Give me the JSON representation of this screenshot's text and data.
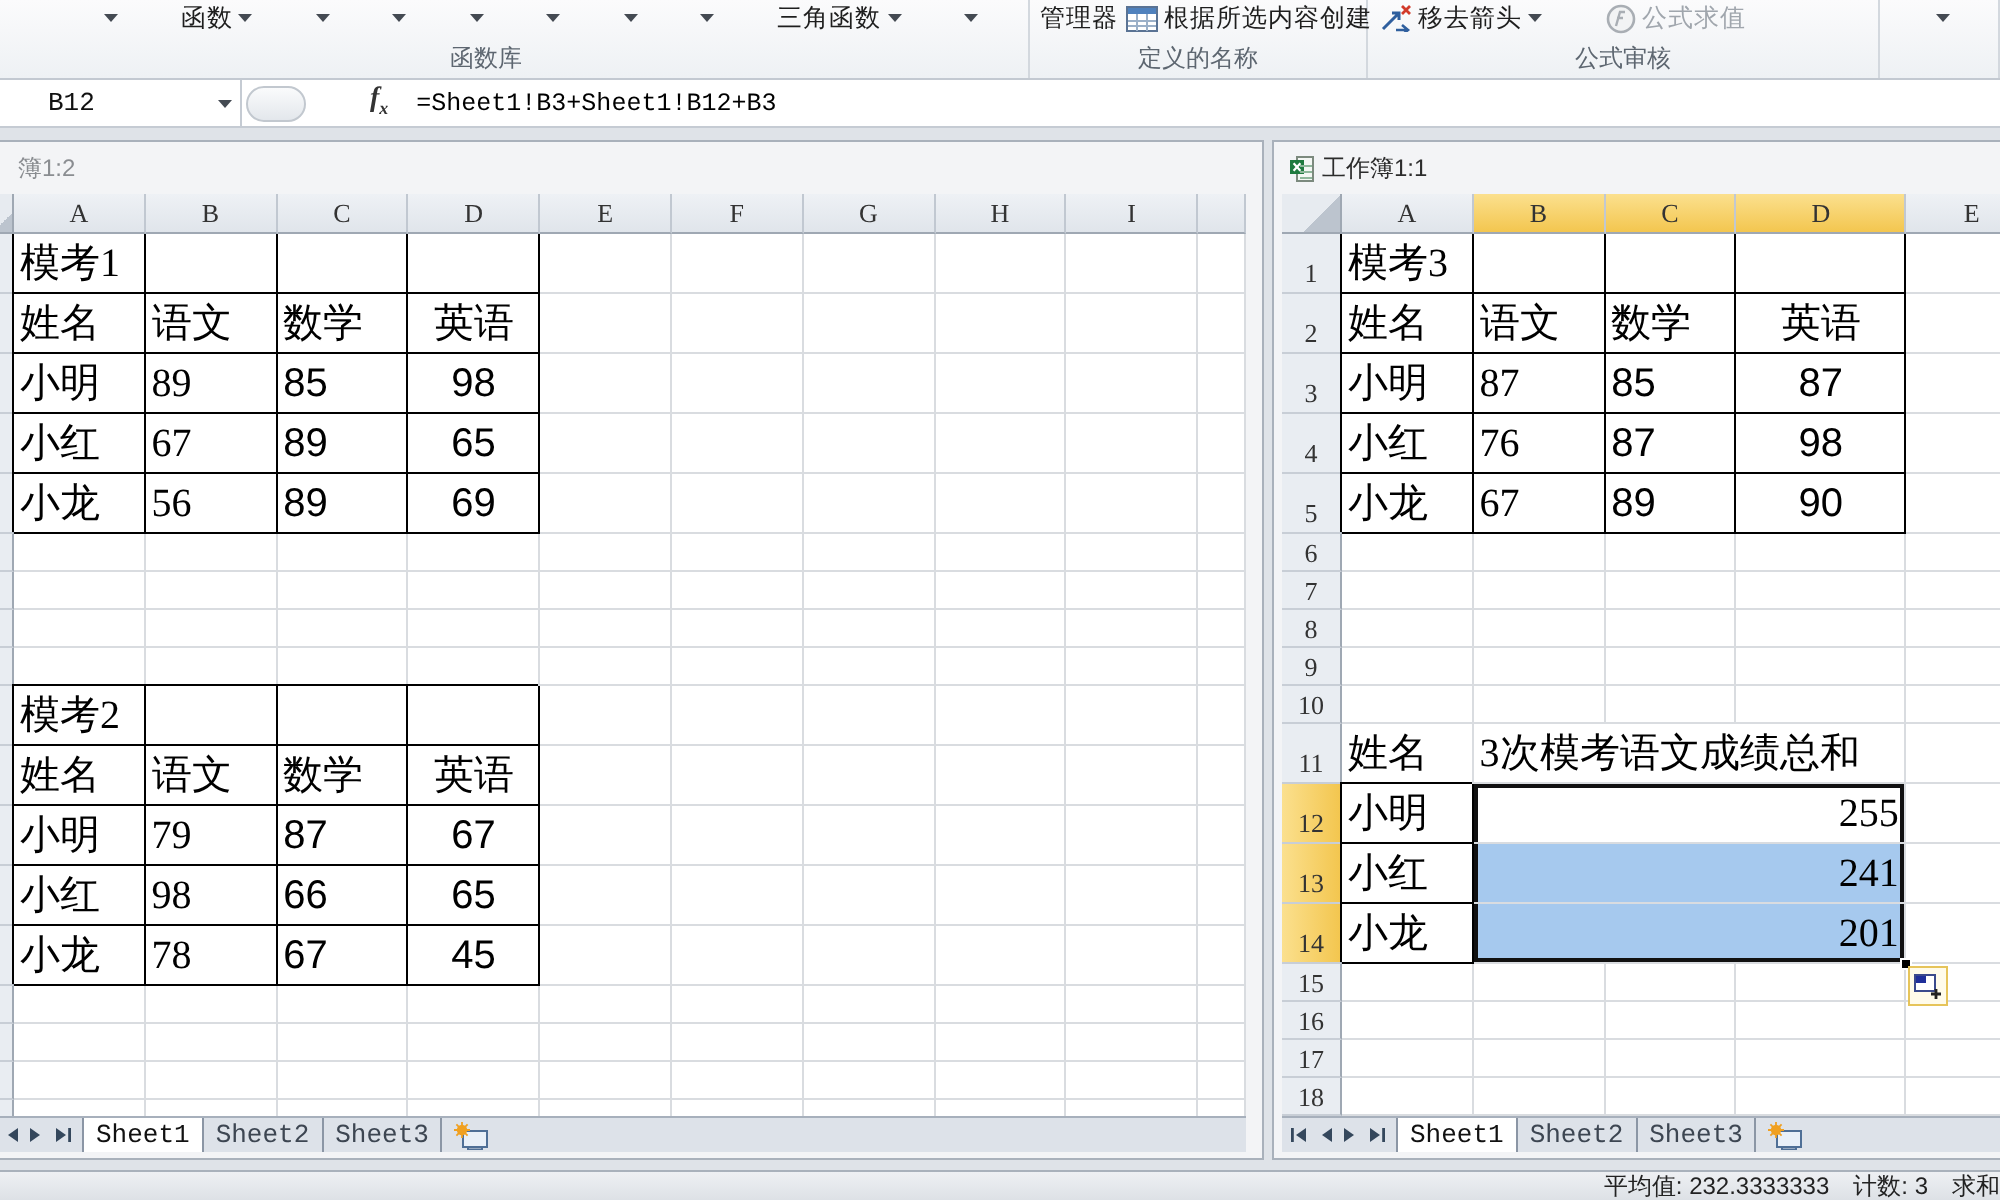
{
  "ribbon": {
    "groups": [
      {
        "label": "函数库",
        "commands": [
          {
            "kind": "caret",
            "disabled": false
          },
          {
            "kind": "menu",
            "label": "函数",
            "disabled": false
          },
          {
            "kind": "caret",
            "disabled": false
          },
          {
            "kind": "caret",
            "disabled": false
          },
          {
            "kind": "caret",
            "disabled": false
          },
          {
            "kind": "caret",
            "disabled": false
          },
          {
            "kind": "caret",
            "disabled": false
          },
          {
            "kind": "caret",
            "disabled": false
          },
          {
            "kind": "menu",
            "label": "三角函数",
            "disabled": false
          },
          {
            "kind": "caret",
            "disabled": false
          }
        ]
      },
      {
        "label": "定义的名称",
        "commands": [
          {
            "kind": "plain",
            "label": "管理器",
            "disabled": false
          },
          {
            "kind": "icon",
            "label": "根据所选内容创建",
            "disabled": false
          }
        ]
      },
      {
        "label": "公式审核",
        "commands": [
          {
            "kind": "iconmenu",
            "label": "移去箭头",
            "disabled": false
          },
          {
            "kind": "icon",
            "label": "公式求值",
            "disabled": true
          }
        ]
      },
      {
        "commands": [
          {
            "kind": "caret",
            "disabled": false
          }
        ]
      }
    ]
  },
  "formula_bar": {
    "name_box": "B12",
    "function_button": "f$_{x}$",
    "formula": "=Sheet1!B3+Sheet1!B12+B3"
  },
  "windows": [
    {
      "title": "簿1:2",
      "active": false,
      "columns": [
        {
          "label": "A",
          "selected": false
        },
        {
          "label": "B",
          "selected": false
        },
        {
          "label": "C",
          "selected": false
        },
        {
          "label": "D",
          "selected": false
        },
        {
          "label": "E",
          "selected": false
        },
        {
          "label": "F",
          "selected": false
        },
        {
          "label": "G",
          "selected": false
        },
        {
          "label": "H",
          "selected": false
        },
        {
          "label": "I",
          "selected": false
        }
      ],
      "rows": [
        {
          "selected": false,
          "cells": [
            {
              "kind": "text",
              "value": "模考1",
              "bordered": true
            },
            {
              "kind": "blank",
              "bordered": true
            },
            {
              "kind": "blank",
              "bordered": true
            },
            {
              "kind": "blank",
              "bordered": true
            }
          ]
        },
        {
          "selected": false,
          "cells": [
            {
              "kind": "text",
              "value": "姓名",
              "bordered": true
            },
            {
              "kind": "text",
              "value": "语文",
              "bordered": true
            },
            {
              "kind": "text",
              "value": "数学",
              "bordered": true
            },
            {
              "kind": "text",
              "value": "英语",
              "bordered": true
            }
          ]
        },
        {
          "selected": false,
          "cells": [
            {
              "kind": "text",
              "value": "小明",
              "bordered": true
            },
            {
              "kind": "number",
              "value": "89",
              "bordered": true
            },
            {
              "kind": "number",
              "value": "85",
              "bordered": true
            },
            {
              "kind": "number",
              "value": "98",
              "bordered": true
            }
          ]
        },
        {
          "selected": false,
          "cells": [
            {
              "kind": "text",
              "value": "小红",
              "bordered": true
            },
            {
              "kind": "number",
              "value": "67",
              "bordered": true
            },
            {
              "kind": "number",
              "value": "89",
              "bordered": true
            },
            {
              "kind": "number",
              "value": "65",
              "bordered": true
            }
          ]
        },
        {
          "selected": false,
          "cells": [
            {
              "kind": "text",
              "value": "小龙",
              "bordered": true
            },
            {
              "kind": "number",
              "value": "56",
              "bordered": true
            },
            {
              "kind": "number",
              "value": "89",
              "bordered": true
            },
            {
              "kind": "number",
              "value": "69",
              "bordered": true
            }
          ]
        },
        {
          "selected": false
        },
        {
          "selected": false
        },
        {
          "selected": false
        },
        {
          "selected": false
        },
        {
          "selected": false,
          "cells": [
            {
              "kind": "text",
              "value": "模考2",
              "bordered": true
            },
            {
              "kind": "blank",
              "bordered": true
            },
            {
              "kind": "blank",
              "bordered": true
            },
            {
              "kind": "blank",
              "bordered": true
            }
          ]
        },
        {
          "selected": false,
          "cells": [
            {
              "kind": "text",
              "value": "姓名",
              "bordered": true
            },
            {
              "kind": "text",
              "value": "语文",
              "bordered": true
            },
            {
              "kind": "text",
              "value": "数学",
              "bordered": true
            },
            {
              "kind": "text",
              "value": "英语",
              "bordered": true
            }
          ]
        },
        {
          "selected": false,
          "cells": [
            {
              "kind": "text",
              "value": "小明",
              "bordered": true
            },
            {
              "kind": "number",
              "value": "79",
              "bordered": true
            },
            {
              "kind": "number",
              "value": "87",
              "bordered": true
            },
            {
              "kind": "number",
              "value": "67",
              "bordered": true
            }
          ]
        },
        {
          "selected": false,
          "cells": [
            {
              "kind": "text",
              "value": "小红",
              "bordered": true
            },
            {
              "kind": "number",
              "value": "98",
              "bordered": true
            },
            {
              "kind": "number",
              "value": "66",
              "bordered": true
            },
            {
              "kind": "number",
              "value": "65",
              "bordered": true
            }
          ]
        },
        {
          "selected": false,
          "cells": [
            {
              "kind": "text",
              "value": "小龙",
              "bordered": true
            },
            {
              "kind": "number",
              "value": "78",
              "bordered": true
            },
            {
              "kind": "number",
              "value": "67",
              "bordered": true
            },
            {
              "kind": "number",
              "value": "45",
              "bordered": true
            }
          ]
        },
        {
          "selected": false
        },
        {
          "selected": false
        },
        {
          "selected": false
        },
        {
          "selected": false
        }
      ],
      "sheet_tabs": [
        {
          "label": "Sheet1",
          "selected": true
        },
        {
          "label": "Sheet2",
          "selected": false
        },
        {
          "label": "Sheet3",
          "selected": false
        }
      ]
    },
    {
      "title": "工作簿1:1",
      "active": true,
      "columns": [
        {
          "label": "A",
          "selected": false
        },
        {
          "label": "B",
          "selected": true
        },
        {
          "label": "C",
          "selected": true
        },
        {
          "label": "D",
          "selected": true
        },
        {
          "label": "E",
          "selected": false
        }
      ],
      "rows": [
        {
          "number": "1",
          "selected": false,
          "cells": [
            {
              "kind": "text",
              "value": "模考3",
              "bordered": true
            },
            {
              "kind": "blank",
              "bordered": true
            },
            {
              "kind": "blank",
              "bordered": true
            },
            {
              "kind": "blank",
              "bordered": true
            }
          ]
        },
        {
          "number": "2",
          "selected": false,
          "cells": [
            {
              "kind": "text",
              "value": "姓名",
              "bordered": true
            },
            {
              "kind": "text",
              "value": "语文",
              "bordered": true
            },
            {
              "kind": "text",
              "value": "数学",
              "bordered": true
            },
            {
              "kind": "text",
              "value": "英语",
              "bordered": true
            }
          ]
        },
        {
          "number": "3",
          "selected": false,
          "cells": [
            {
              "kind": "text",
              "value": "小明",
              "bordered": true
            },
            {
              "kind": "number",
              "value": "87",
              "bordered": true
            },
            {
              "kind": "number",
              "value": "85",
              "bordered": true
            },
            {
              "kind": "number",
              "value": "87",
              "bordered": true
            }
          ]
        },
        {
          "number": "4",
          "selected": false,
          "cells": [
            {
              "kind": "text",
              "value": "小红",
              "bordered": true
            },
            {
              "kind": "number",
              "value": "76",
              "bordered": true
            },
            {
              "kind": "number",
              "value": "87",
              "bordered": true
            },
            {
              "kind": "number",
              "value": "98",
              "bordered": true
            }
          ]
        },
        {
          "number": "5",
          "selected": false,
          "cells": [
            {
              "kind": "text",
              "value": "小龙",
              "bordered": true
            },
            {
              "kind": "number",
              "value": "67",
              "bordered": true
            },
            {
              "kind": "number",
              "value": "89",
              "bordered": true
            },
            {
              "kind": "number",
              "value": "90",
              "bordered": true
            }
          ]
        },
        {
          "number": "6",
          "selected": false
        },
        {
          "number": "7",
          "selected": false
        },
        {
          "number": "8",
          "selected": false
        },
        {
          "number": "9",
          "selected": false
        },
        {
          "number": "10",
          "selected": false
        },
        {
          "number": "11",
          "selected": false,
          "cells": [
            {
              "kind": "text",
              "value": "姓名",
              "bordered": false
            },
            {
              "kind": "text",
              "value": "3次模考语文成绩总和",
              "bordered": false
            }
          ]
        },
        {
          "number": "12",
          "selected": true,
          "cells": [
            {
              "kind": "text",
              "value": "小明",
              "bordered": true
            },
            {
              "kind": "number",
              "value": "255",
              "bordered": false
            }
          ]
        },
        {
          "number": "13",
          "selected": true,
          "cells": [
            {
              "kind": "text",
              "value": "小红",
              "bordered": true
            },
            {
              "kind": "number",
              "value": "241",
              "bordered": false
            }
          ]
        },
        {
          "number": "14",
          "selected": true,
          "cells": [
            {
              "kind": "text",
              "value": "小龙",
              "bordered": true
            },
            {
              "kind": "number",
              "value": "201",
              "bordered": false
            }
          ]
        },
        {
          "number": "15",
          "selected": false
        },
        {
          "number": "16",
          "selected": false
        },
        {
          "number": "17",
          "selected": false
        },
        {
          "number": "18",
          "selected": false
        }
      ],
      "sheet_tabs": [
        {
          "label": "Sheet1",
          "selected": true
        },
        {
          "label": "Sheet2",
          "selected": false
        },
        {
          "label": "Sheet3",
          "selected": false
        }
      ]
    }
  ],
  "status_bar": {
    "items": [
      "平均值: 232.3333333",
      "计数: 3",
      "求和"
    ]
  }
}
